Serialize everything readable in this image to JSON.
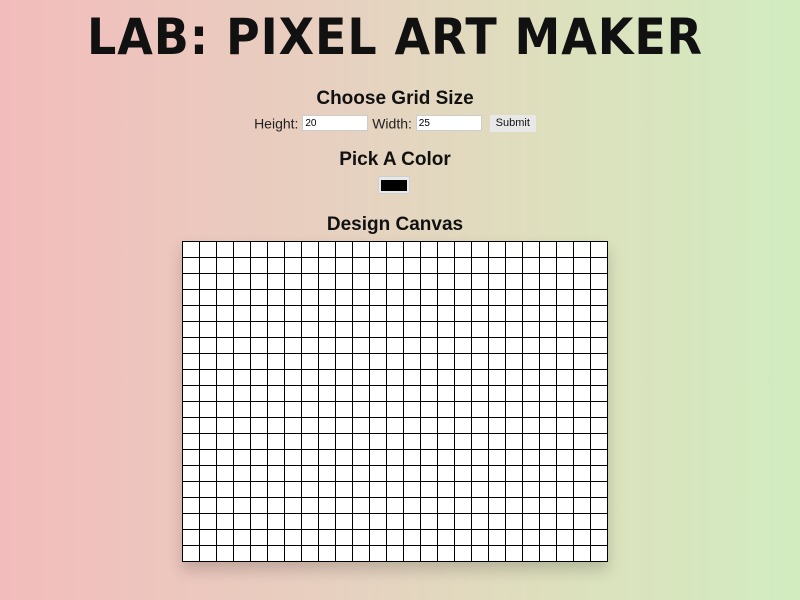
{
  "page_title": "LAB: Pixel Art Maker",
  "grid_section": {
    "heading": "Choose Grid Size",
    "height_label": "Height:",
    "height_value": "20",
    "width_label": "Width:",
    "width_value": "25",
    "submit_label": "Submit"
  },
  "color_section": {
    "heading": "Pick A Color",
    "selected_color": "#000000"
  },
  "canvas_section": {
    "heading": "Design Canvas",
    "rows": 20,
    "columns": 25,
    "cell_color": "#ffffff",
    "border_color": "#000000"
  }
}
